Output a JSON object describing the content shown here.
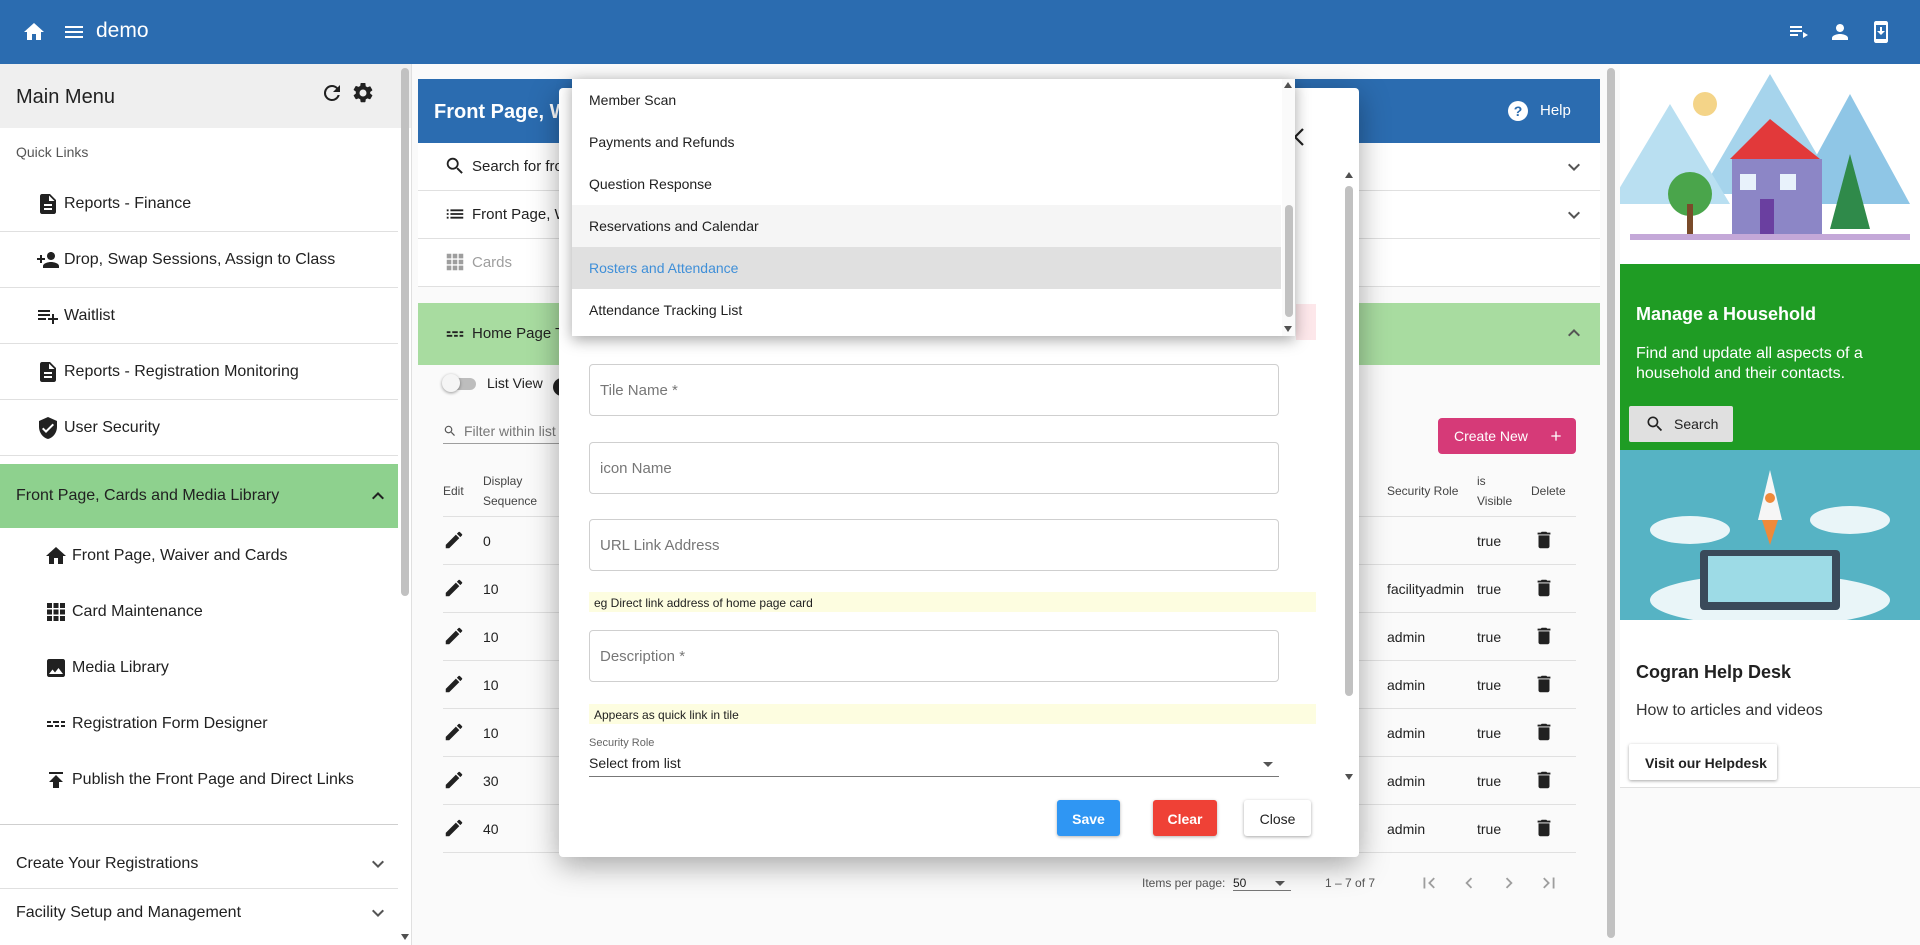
{
  "app": {
    "title": "demo"
  },
  "sidebar": {
    "title": "Main Menu",
    "quick_links_label": "Quick Links",
    "quick_links": [
      {
        "label": "Reports - Finance",
        "icon": "document-icon"
      },
      {
        "label": "Drop, Swap Sessions, Assign to Class",
        "icon": "person-add-icon"
      },
      {
        "label": "Waitlist",
        "icon": "playlist-add-icon"
      },
      {
        "label": "Reports - Registration Monitoring",
        "icon": "document-icon"
      },
      {
        "label": "User Security",
        "icon": "shield-check-icon"
      }
    ],
    "section": {
      "label": "Front Page, Cards and Media Library",
      "items": [
        {
          "label": "Front Page, Waiver and Cards",
          "icon": "home-icon"
        },
        {
          "label": "Card Maintenance",
          "icon": "grid-icon"
        },
        {
          "label": "Media Library",
          "icon": "image-icon"
        },
        {
          "label": "Registration Form Designer",
          "icon": "dashes-icon"
        },
        {
          "label": "Publish the Front Page and Direct Links",
          "icon": "publish-icon"
        }
      ]
    },
    "collapsed_sections": [
      {
        "label": "Create Your Registrations"
      },
      {
        "label": "Facility Setup and Management"
      }
    ]
  },
  "main": {
    "banner_title": "Front Page, W",
    "help_label": "Help",
    "rows": [
      {
        "label": "Search for fro",
        "icon": "search-icon"
      },
      {
        "label": "Front Page, W",
        "icon": "list-icon"
      },
      {
        "label": "Cards",
        "icon": "grid-icon"
      }
    ],
    "green_row_label": "Home Page T",
    "list_view_label": "List View",
    "filter_placeholder": "Filter within list",
    "create_new_label": "Create New",
    "table": {
      "headers": {
        "edit": "Edit",
        "display": "Display",
        "sequence": "Sequence",
        "security_role": "Security Role",
        "is": "is",
        "visible": "Visible",
        "delete": "Delete"
      },
      "rows": [
        {
          "seq": "0",
          "role": "",
          "visible": "true"
        },
        {
          "seq": "10",
          "role": "facilityadmin",
          "visible": "true"
        },
        {
          "seq": "10",
          "role": "admin",
          "visible": "true"
        },
        {
          "seq": "10",
          "role": "admin",
          "visible": "true"
        },
        {
          "seq": "10",
          "role": "admin",
          "visible": "true"
        },
        {
          "seq": "30",
          "role": "admin",
          "visible": "true"
        },
        {
          "seq": "40",
          "role": "admin",
          "visible": "true"
        }
      ]
    },
    "pager": {
      "items_per_page_label": "Items per page:",
      "items_per_page": "50",
      "range": "1 – 7 of 7"
    }
  },
  "right_panel": {
    "household": {
      "title": "Manage a Household",
      "desc": "Find and update all aspects of a household and their contacts.",
      "button": "Search"
    },
    "helpdesk": {
      "title": "Cogran Help Desk",
      "desc": "How to articles and videos",
      "button": "Visit our Helpdesk"
    }
  },
  "dialog": {
    "fields": {
      "tile_name": "Tile Name *",
      "icon_name": "icon Name",
      "url": "URL Link Address",
      "description": "Description *"
    },
    "hints": {
      "url": "eg Direct link address of home page card",
      "description": "Appears as quick link in tile"
    },
    "security_role": {
      "label": "Security Role",
      "value": "Select from list"
    },
    "buttons": {
      "save": "Save",
      "clear": "Clear",
      "close": "Close"
    }
  },
  "dropdown": {
    "options": [
      {
        "label": "Member Scan"
      },
      {
        "label": "Payments and Refunds"
      },
      {
        "label": "Question Response"
      },
      {
        "label": "Reservations and Calendar"
      },
      {
        "label": "Rosters and Attendance"
      },
      {
        "label": "Attendance Tracking List"
      }
    ],
    "selected": "Rosters and Attendance"
  },
  "colors": {
    "primary": "#2b6cb0",
    "sidebar_section": "#8ed18e",
    "household_green": "#1f9c24",
    "create_pink": "#d63a78",
    "save_blue": "#2f96f3",
    "clear_red": "#ef4136"
  }
}
